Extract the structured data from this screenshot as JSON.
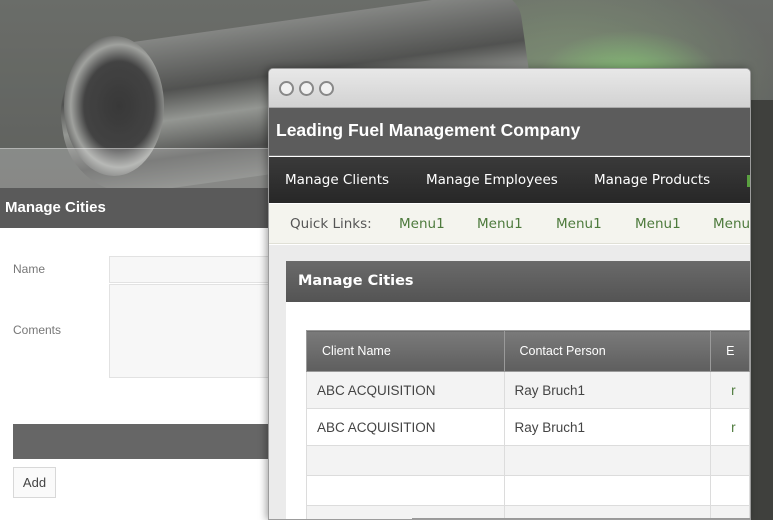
{
  "background_page": {
    "title": "Manage Cities",
    "form": {
      "name_label": "Name",
      "name_value": "",
      "comments_label": "Coments",
      "comments_value": "",
      "add_label": "Add"
    }
  },
  "window": {
    "header": {
      "company_name": "Leading Fuel Management Company"
    },
    "nav": {
      "items": [
        "Manage Clients",
        "Manage Employees",
        "Manage Products"
      ]
    },
    "quick_links": {
      "label": "Quick Links:",
      "items": [
        "Menu1",
        "Menu1",
        "Menu1",
        "Menu1",
        "Menu"
      ]
    },
    "panel": {
      "title": "Manage Cities",
      "columns": [
        "Client Name",
        "Contact Person",
        "E"
      ],
      "rows": [
        [
          "ABC ACQUISITION",
          "Ray Bruch1",
          "r"
        ],
        [
          "ABC ACQUISITION",
          "Ray Bruch1",
          "r"
        ],
        [
          "",
          "",
          ""
        ],
        [
          "",
          "",
          ""
        ],
        [
          "",
          "",
          ""
        ]
      ]
    }
  },
  "colors": {
    "accent_green": "#4d7a3c",
    "header_grey": "#5c5c5c",
    "nav_dark": "#2f2f2f"
  }
}
